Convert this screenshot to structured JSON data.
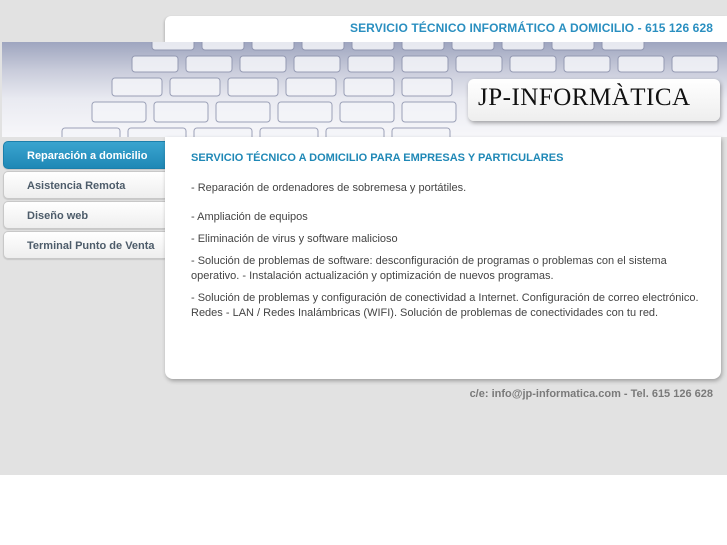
{
  "header": {
    "title": "SERVICIO TÉCNICO INFORMÁTICO A DOMICILIO - 615 126 628"
  },
  "banner": {
    "logo_text": "JP-INFORMÀTICA"
  },
  "sidebar": {
    "items": [
      {
        "label": "Reparación a domicilio",
        "active": true
      },
      {
        "label": "Asistencia Remota",
        "active": false
      },
      {
        "label": "Diseño web",
        "active": false
      },
      {
        "label": "Terminal Punto de Venta",
        "active": false
      }
    ]
  },
  "main": {
    "heading": "SERVICIO TÉCNICO A DOMICILIO PARA EMPRESAS Y PARTICULARES",
    "paragraphs": [
      "- Reparación de ordenadores de sobremesa y portátiles.",
      "- Ampliación de equipos",
      "- Eliminación de virus y software malicioso",
      "- Solución de problemas de software: desconfiguración de programas o problemas con el sistema operativo. - Instalación actualización y optimización de nuevos programas.",
      "- Solución de problemas y configuración de conectividad a Internet. Configuración de correo electrónico. Redes - LAN / Redes Inalámbricas (WIFI). Solución de problemas de conectividades con tu red."
    ]
  },
  "footer": {
    "contact": "c/e: info@jp-informatica.com - Tel. 615 126 628"
  },
  "colors": {
    "accent": "#1f88b6",
    "header_text": "#2a8fc0",
    "page_bg": "#e2e2e2"
  }
}
